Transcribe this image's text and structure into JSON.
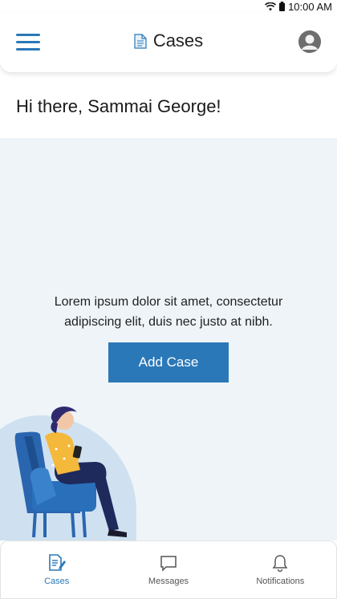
{
  "status": {
    "time": "10:00 AM"
  },
  "header": {
    "title": "Cases"
  },
  "greeting": "Hi there, Sammai George!",
  "main": {
    "description": "Lorem ipsum dolor sit amet, consectetur adipiscing elit, duis nec justo at nibh.",
    "add_button": "Add Case"
  },
  "tabs": [
    {
      "label": "Cases",
      "icon": "cases-icon",
      "active": true
    },
    {
      "label": "Messages",
      "icon": "messages-icon",
      "active": false
    },
    {
      "label": "Notifications",
      "icon": "bell-icon",
      "active": false
    }
  ],
  "colors": {
    "accent": "#2a78b8",
    "background": "#eef4f8",
    "blob": "#cfe1f0"
  }
}
